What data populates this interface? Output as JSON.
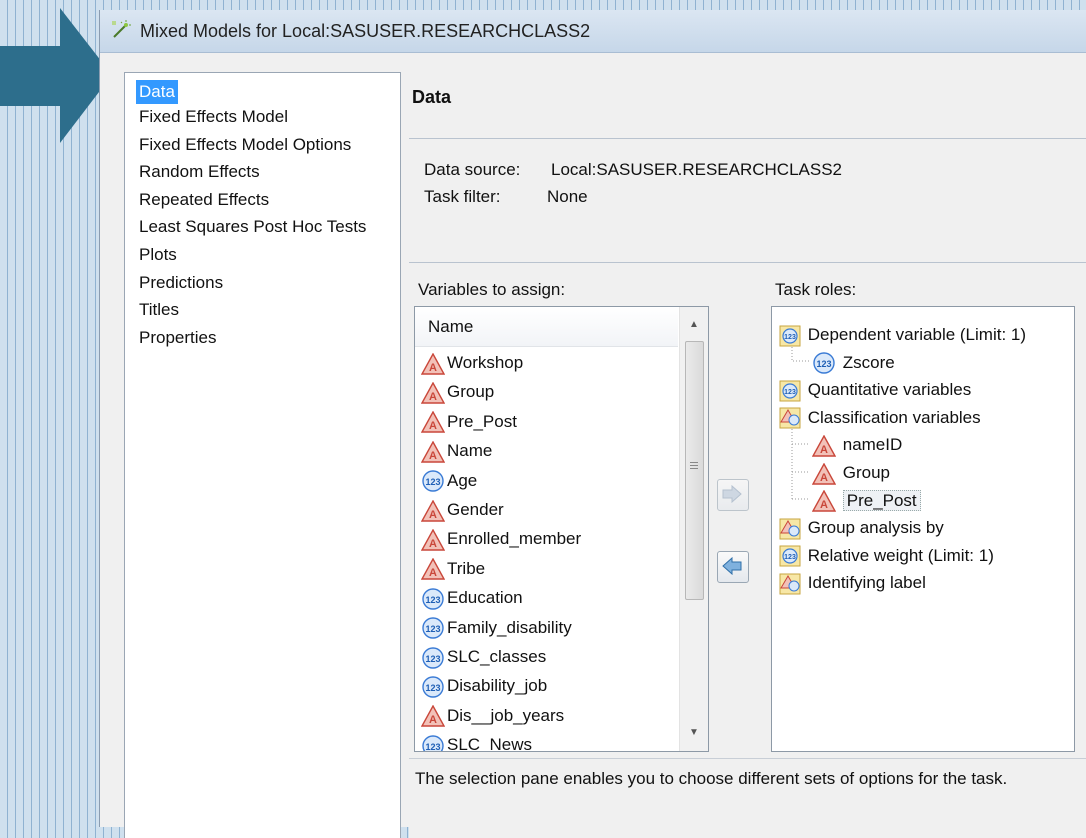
{
  "window": {
    "title": "Mixed Models for Local:SASUSER.RESEARCHCLASS2"
  },
  "nav": {
    "items": [
      {
        "label": "Data",
        "selected": true
      },
      {
        "label": "Fixed Effects Model"
      },
      {
        "label": "Fixed Effects Model Options"
      },
      {
        "label": "Random Effects"
      },
      {
        "label": "Repeated Effects"
      },
      {
        "label": "Least Squares Post Hoc Tests"
      },
      {
        "label": "Plots"
      },
      {
        "label": "Predictions"
      },
      {
        "label": "Titles"
      },
      {
        "label": "Properties"
      }
    ]
  },
  "panel": {
    "heading": "Data",
    "data_source_label": "Data source:",
    "data_source_value": "Local:SASUSER.RESEARCHCLASS2",
    "task_filter_label": "Task filter:",
    "task_filter_value": "None"
  },
  "variables": {
    "label": "Variables to assign:",
    "column_header": "Name",
    "items": [
      {
        "name": "Workshop",
        "type": "character"
      },
      {
        "name": "Group",
        "type": "character"
      },
      {
        "name": "Pre_Post",
        "type": "character"
      },
      {
        "name": "Name",
        "type": "character"
      },
      {
        "name": "Age",
        "type": "numeric"
      },
      {
        "name": "Gender",
        "type": "character"
      },
      {
        "name": "Enrolled_member",
        "type": "character"
      },
      {
        "name": "Tribe",
        "type": "character"
      },
      {
        "name": "Education",
        "type": "numeric"
      },
      {
        "name": "Family_disability",
        "type": "numeric"
      },
      {
        "name": "SLC_classes",
        "type": "numeric"
      },
      {
        "name": "Disability_job",
        "type": "numeric"
      },
      {
        "name": "Dis__job_years",
        "type": "character"
      },
      {
        "name": "SLC_News",
        "type": "numeric"
      }
    ]
  },
  "roles": {
    "label": "Task roles:",
    "items": [
      {
        "label": "Dependent variable  (Limit: 1)",
        "icon": "numeric-role",
        "level": 0
      },
      {
        "label": "Zscore",
        "icon": "numeric",
        "level": 1
      },
      {
        "label": "Quantitative variables",
        "icon": "numeric-role",
        "level": 0
      },
      {
        "label": "Classification variables",
        "icon": "class-role",
        "level": 0
      },
      {
        "label": "nameID",
        "icon": "character",
        "level": 1
      },
      {
        "label": "Group",
        "icon": "character",
        "level": 1
      },
      {
        "label": "Pre_Post",
        "icon": "character",
        "level": 1,
        "selected": true
      },
      {
        "label": "Group analysis by",
        "icon": "class-role",
        "level": 0
      },
      {
        "label": "Relative weight  (Limit: 1)",
        "icon": "numeric-role",
        "level": 0
      },
      {
        "label": "Identifying label",
        "icon": "class-role",
        "level": 0
      }
    ]
  },
  "help": {
    "text": "The selection pane enables you to choose different sets of options for the task."
  },
  "colors": {
    "selection": "#3399ff",
    "arrow": "#2d6e8c",
    "character_icon": "#e06a5a",
    "numeric_icon": "#3a7bd5"
  }
}
